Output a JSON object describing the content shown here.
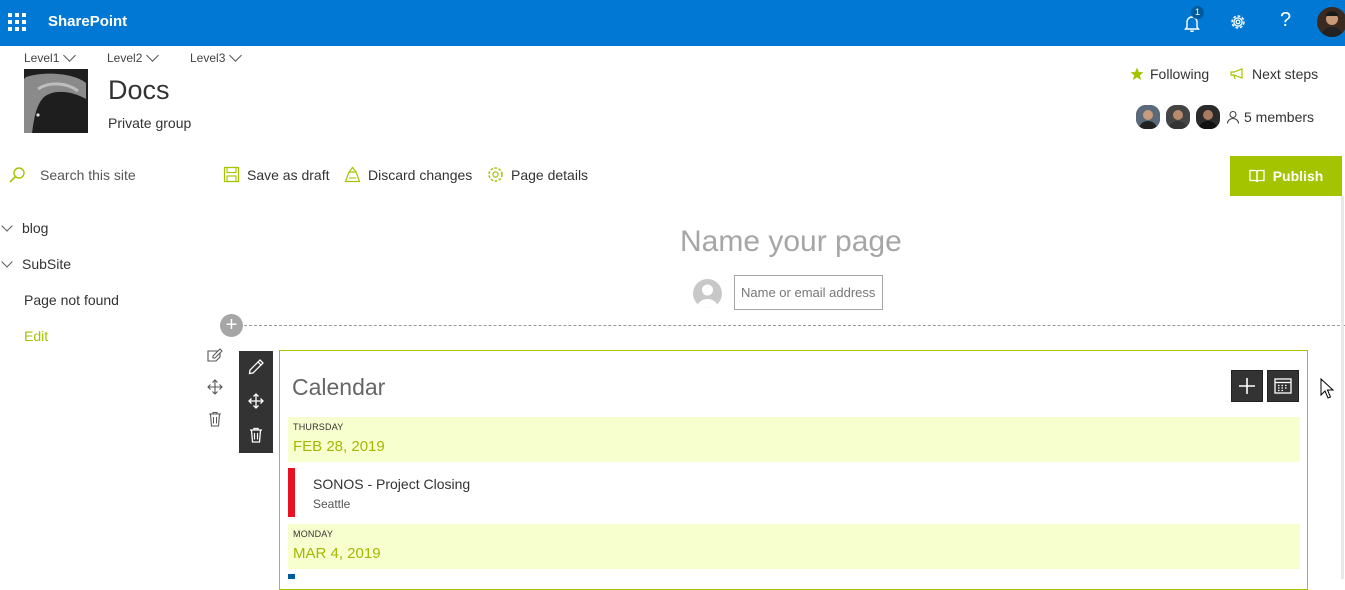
{
  "suite": {
    "app_name": "SharePoint",
    "notification_count": "1",
    "help_glyph": "?"
  },
  "breadcrumbs": [
    {
      "label": "Level1"
    },
    {
      "label": "Level2"
    },
    {
      "label": "Level3"
    }
  ],
  "site": {
    "title": "Docs",
    "subtitle": "Private group"
  },
  "header_actions": {
    "following": "Following",
    "next_steps": "Next steps",
    "members": "5 members"
  },
  "command_bar": {
    "search_placeholder": "Search this site",
    "save_draft": "Save as draft",
    "discard": "Discard changes",
    "page_details": "Page details",
    "publish": "Publish"
  },
  "nav": [
    {
      "label": "blog"
    },
    {
      "label": "SubSite"
    },
    {
      "label": "Page not found"
    },
    {
      "label": "Edit"
    }
  ],
  "page": {
    "title_placeholder": "Name your page",
    "author_placeholder": "Name or email address"
  },
  "calendar": {
    "title": "Calendar",
    "groups": [
      {
        "day": "THURSDAY",
        "date": "FEB 28, 2019",
        "events": [
          {
            "title": "SONOS - Project Closing",
            "location": "Seattle",
            "color": "#e81123"
          }
        ]
      },
      {
        "day": "MONDAY",
        "date": "MAR 4, 2019",
        "events": [
          {
            "title": "",
            "location": "",
            "color": "#005a9e"
          }
        ]
      }
    ]
  },
  "colors": {
    "suite_bar": "#0078d4",
    "accent": "#a4c400",
    "date_band": "#f7ffcf"
  }
}
